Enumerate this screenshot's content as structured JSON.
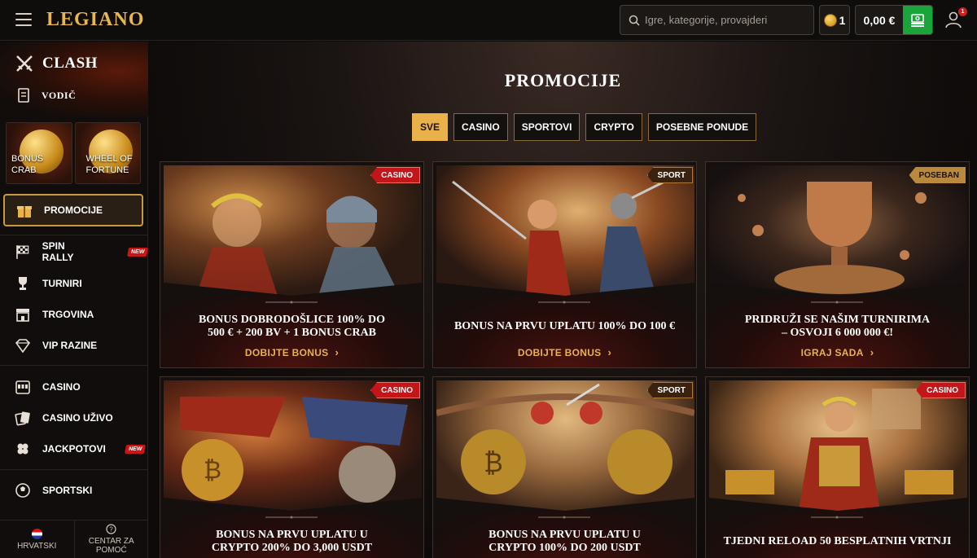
{
  "header": {
    "brand": "LEGIANO",
    "search_placeholder": "Igre, kategorije, provajderi",
    "coins_count": "1",
    "balance": "0,00 €",
    "notification_count": "1"
  },
  "sidebar": {
    "clash_label": "CLASH",
    "vodic_label": "VODIČ",
    "tiles": [
      {
        "label_line1": "BONUS",
        "label_line2": "CRAB"
      },
      {
        "label_line1": "WHEEL OF",
        "label_line2": "FORTUNE"
      }
    ],
    "active_item": "PROMOCIJE",
    "group1": [
      {
        "label": "SPIN RALLY",
        "badge": "NEW",
        "icon": "checkered-flag-icon"
      },
      {
        "label": "TURNIRI",
        "icon": "trophy-icon"
      },
      {
        "label": "TRGOVINA",
        "icon": "shop-icon"
      },
      {
        "label": "VIP RAZINE",
        "icon": "diamond-icon"
      }
    ],
    "group2": [
      {
        "label": "CASINO",
        "icon": "slot-machine-icon"
      },
      {
        "label": "CASINO UŽIVO",
        "icon": "cards-icon"
      },
      {
        "label": "JACKPOTOVI",
        "badge": "NEW",
        "icon": "clover-icon"
      }
    ],
    "group3": [
      {
        "label": "SPORTSKI",
        "icon": "ball-icon"
      }
    ],
    "footer": {
      "language": "HRVATSKI",
      "help_line1": "CENTAR ZA",
      "help_line2": "POMOĆ"
    }
  },
  "main": {
    "title": "PROMOCIJE",
    "filters": [
      "SVE",
      "CASINO",
      "SPORTOVI",
      "CRYPTO",
      "POSEBNE PONUDE"
    ],
    "active_filter": "SVE",
    "cards": [
      {
        "tag": "CASINO",
        "title_line1": "BONUS DOBRODOŠLICE 100% DO",
        "title_line2": "500 € + 200 BV + 1 BONUS CRAB",
        "cta": "DOBIJTE BONUS"
      },
      {
        "tag": "SPORT",
        "title_line1": "BONUS NA PRVU UPLATU 100% DO 100 €",
        "title_line2": "",
        "cta": "DOBIJTE BONUS"
      },
      {
        "tag": "POSEBAN",
        "title_line1": "PRIDRUŽI SE NAŠIM TURNIRIMA",
        "title_line2": "– OSVOJI 6 000 000 €!",
        "cta": "IGRAJ SADA"
      },
      {
        "tag": "CASINO",
        "title_line1": "BONUS NA PRVU UPLATU U",
        "title_line2": "CRYPTO 200% DO 3,000 USDT",
        "cta": ""
      },
      {
        "tag": "SPORT",
        "title_line1": "BONUS NA PRVU UPLATU U",
        "title_line2": "CRYPTO 100% DO 200 USDT",
        "cta": ""
      },
      {
        "tag": "CASINO",
        "title_line1": "TJEDNI RELOAD 50 BESPLATNIH VRTNJI",
        "title_line2": "",
        "cta": ""
      }
    ]
  },
  "colors": {
    "accent_gold": "#e9b14a",
    "deposit_green": "#1aa53a",
    "casino_tag_red": "#c2161a"
  }
}
